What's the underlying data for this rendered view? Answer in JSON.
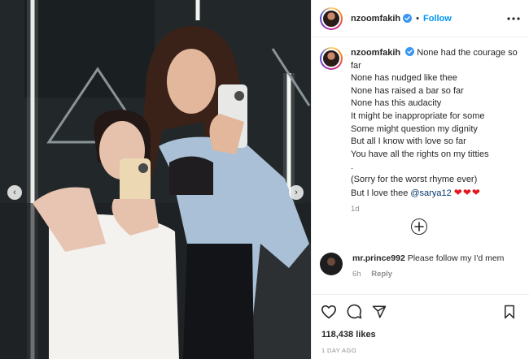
{
  "post": {
    "username": "nzoomfakih",
    "follow_label": "Follow",
    "caption_lines": [
      "None had the courage so far",
      "None has nudged like thee",
      "None has raised a bar so far",
      "None has this audacity",
      "It might be inappropriate for some",
      "Some might question my dignity",
      "But all I know with love so far",
      "You have all the rights on my titties",
      ".",
      "(Sorry for the worst rhyme ever)"
    ],
    "caption_last_prefix": "But I love thee ",
    "mention": "@sarya12",
    "hearts": "❤❤❤",
    "caption_time": "1d",
    "likes": "118,438 likes",
    "date": "1 DAY AGO"
  },
  "comment": {
    "username": "mr.prince992",
    "text": "Please follow my I'd mem",
    "time": "6h",
    "reply_label": "Reply"
  },
  "icons": {
    "verified": "verified-badge-icon",
    "more": "more-options-icon",
    "add": "add-comment-icon",
    "like": "heart-icon",
    "comment": "comment-icon",
    "share": "share-icon",
    "save": "bookmark-icon",
    "prev": "chevron-left-icon",
    "next": "chevron-right-icon"
  },
  "colors": {
    "accent": "#0095f6",
    "verified": "#3897f0",
    "mention": "#00376b",
    "heart": "#e0191f",
    "muted": "#8e8e8e"
  }
}
